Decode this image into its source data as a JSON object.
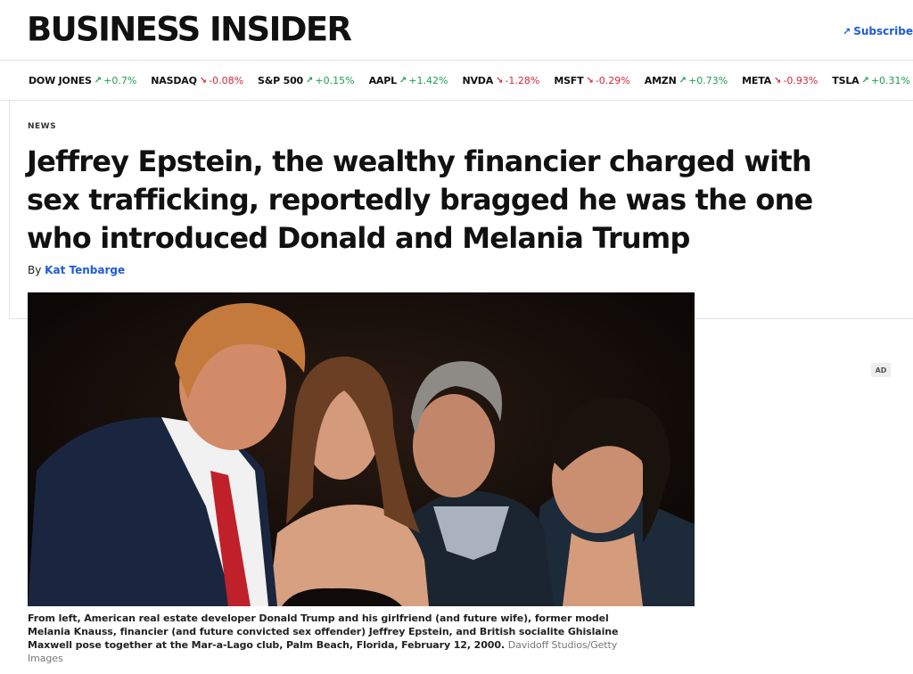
{
  "header": {
    "logo": "BUSINESS INSIDER",
    "subscribe_label": "Subscribe",
    "subscribe_icon": "arrow-up-right-icon"
  },
  "ticker": [
    {
      "symbol": "DOW JONES",
      "direction": "up",
      "change": "+0.7%"
    },
    {
      "symbol": "NASDAQ",
      "direction": "down",
      "change": "-0.08%"
    },
    {
      "symbol": "S&P 500",
      "direction": "up",
      "change": "+0.15%"
    },
    {
      "symbol": "AAPL",
      "direction": "up",
      "change": "+1.42%"
    },
    {
      "symbol": "NVDA",
      "direction": "down",
      "change": "-1.28%"
    },
    {
      "symbol": "MSFT",
      "direction": "down",
      "change": "-0.29%"
    },
    {
      "symbol": "AMZN",
      "direction": "up",
      "change": "+0.73%"
    },
    {
      "symbol": "META",
      "direction": "down",
      "change": "-0.93%"
    },
    {
      "symbol": "TSLA",
      "direction": "up",
      "change": "+0.31%"
    }
  ],
  "article": {
    "category": "NEWS",
    "headline": "Jeffrey Epstein, the wealthy financier charged with sex trafficking, reportedly bragged he was the one who introduced Donald and Melania Trump",
    "byline_prefix": "By",
    "author": "Kat Tenbarge",
    "caption": "From left, American real estate developer Donald Trump and his girlfriend (and future wife), former model Melania Knauss, financier (and future convicted sex offender) Jeffrey Epstein, and British socialite Ghislaine Maxwell pose together at the Mar-a-Lago club, Palm Beach, Florida, February 12, 2000.",
    "credit": "Davidoff Studios/Getty Images"
  },
  "ad": {
    "label": "AD"
  },
  "colors": {
    "brand_link": "#1e5bd6",
    "up": "#1f9d55",
    "down": "#d7263d"
  }
}
